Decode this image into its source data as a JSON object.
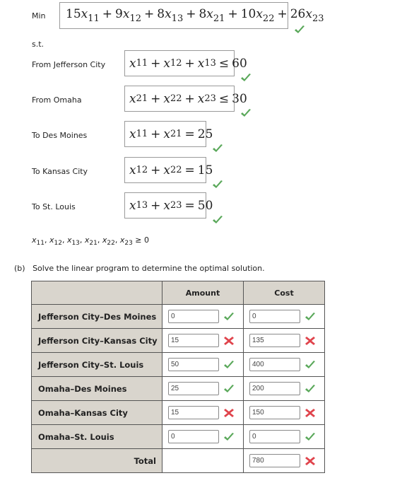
{
  "objective": {
    "label": "Min",
    "terms": [
      {
        "coef": "15",
        "var": "x",
        "sub": "11"
      },
      {
        "coef": "9",
        "var": "x",
        "sub": "12"
      },
      {
        "coef": "8",
        "var": "x",
        "sub": "13"
      },
      {
        "coef": "8",
        "var": "x",
        "sub": "21"
      },
      {
        "coef": "10",
        "var": "x",
        "sub": "22"
      },
      {
        "coef": "26",
        "var": "x",
        "sub": "23"
      }
    ],
    "status": "correct"
  },
  "st_label": "s.t.",
  "constraints": [
    {
      "label": "From Jefferson City",
      "vars": [
        "11",
        "12",
        "13"
      ],
      "op": "≤",
      "rhs": "60",
      "status": "correct"
    },
    {
      "label": "From Omaha",
      "vars": [
        "21",
        "22",
        "23"
      ],
      "op": "≤",
      "rhs": "30",
      "status": "correct"
    },
    {
      "label": "To Des Moines",
      "vars": [
        "11",
        "21"
      ],
      "op": "=",
      "rhs": "25",
      "status": "correct"
    },
    {
      "label": "To Kansas City",
      "vars": [
        "12",
        "22"
      ],
      "op": "=",
      "rhs": "15",
      "status": "correct"
    },
    {
      "label": "To St. Louis",
      "vars": [
        "13",
        "23"
      ],
      "op": "=",
      "rhs": "50",
      "status": "correct"
    }
  ],
  "nonnegativity": {
    "vars": [
      "11",
      "12",
      "13",
      "21",
      "22",
      "23"
    ],
    "text": "≥ 0"
  },
  "part_b": {
    "marker": "(b)",
    "text": "Solve the linear program to determine the optimal solution."
  },
  "table": {
    "headers": [
      "",
      "Amount",
      "Cost"
    ],
    "rows": [
      {
        "route": "Jefferson City–Des Moines",
        "amount": "0",
        "amount_status": "correct",
        "cost": "0",
        "cost_status": "correct"
      },
      {
        "route": "Jefferson City–Kansas City",
        "amount": "15",
        "amount_status": "incorrect",
        "cost": "135",
        "cost_status": "incorrect"
      },
      {
        "route": "Jefferson City–St. Louis",
        "amount": "50",
        "amount_status": "correct",
        "cost": "400",
        "cost_status": "correct"
      },
      {
        "route": "Omaha–Des Moines",
        "amount": "25",
        "amount_status": "correct",
        "cost": "200",
        "cost_status": "correct"
      },
      {
        "route": "Omaha–Kansas City",
        "amount": "15",
        "amount_status": "incorrect",
        "cost": "150",
        "cost_status": "incorrect"
      },
      {
        "route": "Omaha–St. Louis",
        "amount": "0",
        "amount_status": "correct",
        "cost": "0",
        "cost_status": "correct"
      }
    ],
    "total": {
      "label": "Total",
      "cost": "780",
      "cost_status": "incorrect"
    }
  },
  "colors": {
    "check": "#5aa85a",
    "cross": "#e0444c",
    "header_bg": "#d9d5cd"
  }
}
